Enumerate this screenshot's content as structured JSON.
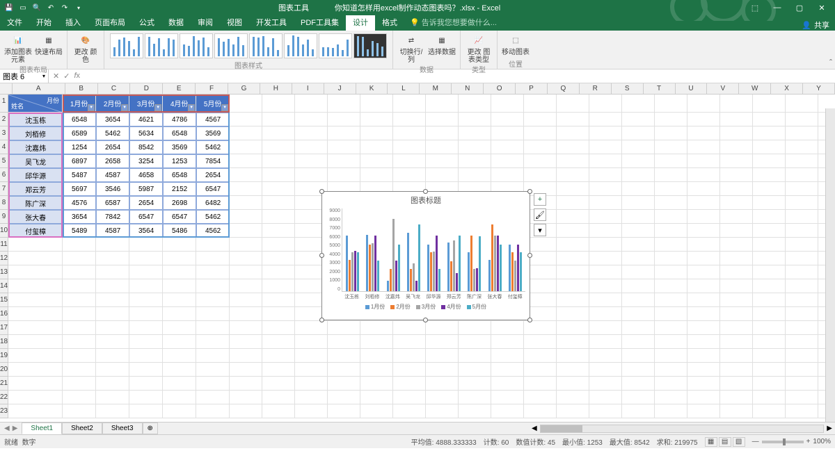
{
  "title_context": "图表工具",
  "title_file": "你知道怎样用excel制作动态图表吗？.xlsx - Excel",
  "menutabs": [
    "文件",
    "开始",
    "插入",
    "页面布局",
    "公式",
    "数据",
    "审阅",
    "视图",
    "开发工具",
    "PDF工具集",
    "设计",
    "格式"
  ],
  "menutab_active_index": 10,
  "tellme": "告诉我您想要做什么...",
  "share": "共享",
  "ribbon": {
    "layout_group": {
      "add_elem": "添加图表\n元素",
      "quick": "快速布局",
      "name": "图表布局"
    },
    "color": "更改\n颜色",
    "styles_group_name": "图表样式",
    "data_group": {
      "switch": "切换行/列",
      "select": "选择数据",
      "name": "数据"
    },
    "type_group": {
      "change": "更改\n图表类型",
      "name": "类型"
    },
    "loc_group": {
      "move": "移动图表",
      "name": "位置"
    }
  },
  "namebox": "图表 6",
  "columns": [
    "A",
    "B",
    "C",
    "D",
    "E",
    "F",
    "G",
    "H",
    "I",
    "J",
    "K",
    "L",
    "M",
    "N",
    "O",
    "P",
    "Q",
    "R",
    "S",
    "T",
    "U",
    "V",
    "W",
    "X",
    "Y"
  ],
  "row_count": 23,
  "table": {
    "corner_top": "月份",
    "corner_bottom": "姓名",
    "headers": [
      "1月份",
      "2月份",
      "3月份",
      "4月份",
      "5月份"
    ],
    "rows": [
      {
        "name": "沈玉栋",
        "v": [
          6548,
          3654,
          4621,
          4786,
          4567
        ]
      },
      {
        "name": "刘栢修",
        "v": [
          6589,
          5462,
          5634,
          6548,
          3569
        ]
      },
      {
        "name": "沈嘉炜",
        "v": [
          1254,
          2654,
          8542,
          3569,
          5462
        ]
      },
      {
        "name": "吴飞龙",
        "v": [
          6897,
          2658,
          3254,
          1253,
          7854
        ]
      },
      {
        "name": "邱华源",
        "v": [
          5487,
          4587,
          4658,
          6548,
          2654
        ]
      },
      {
        "name": "郑云芳",
        "v": [
          5697,
          3546,
          5987,
          2152,
          6547
        ]
      },
      {
        "name": "陈广深",
        "v": [
          4576,
          6587,
          2654,
          2698,
          6482
        ]
      },
      {
        "name": "张大春",
        "v": [
          3654,
          7842,
          6547,
          6547,
          5462
        ]
      },
      {
        "name": "付玺樟",
        "v": [
          5489,
          4587,
          3564,
          5486,
          4562
        ]
      }
    ]
  },
  "chart_data": {
    "type": "bar",
    "title": "图表标题",
    "categories": [
      "沈玉栋",
      "刘栢修",
      "沈嘉炜",
      "吴飞龙",
      "邱华源",
      "郑云芳",
      "陈广深",
      "张大春",
      "付玺樟"
    ],
    "series": [
      {
        "name": "1月份",
        "color": "#5b9bd5",
        "values": [
          6548,
          6589,
          1254,
          6897,
          5487,
          5697,
          4576,
          3654,
          5489
        ]
      },
      {
        "name": "2月份",
        "color": "#ed7d31",
        "values": [
          3654,
          5462,
          2654,
          2658,
          4587,
          3546,
          6587,
          7842,
          4587
        ]
      },
      {
        "name": "3月份",
        "color": "#a5a5a5",
        "values": [
          4621,
          5634,
          8542,
          3254,
          4658,
          5987,
          2654,
          6547,
          3564
        ]
      },
      {
        "name": "4月份",
        "color": "#7030a0",
        "values": [
          4786,
          6548,
          3569,
          1253,
          6548,
          2152,
          2698,
          6547,
          5486
        ]
      },
      {
        "name": "5月份",
        "color": "#4bacc6",
        "values": [
          4567,
          3569,
          5462,
          7854,
          2654,
          6547,
          6482,
          5462,
          4562
        ]
      }
    ],
    "yticks": [
      0,
      1000,
      2000,
      3000,
      4000,
      5000,
      6000,
      7000,
      8000,
      9000
    ],
    "ylim": [
      0,
      9000
    ]
  },
  "sheets": [
    "Sheet1",
    "Sheet2",
    "Sheet3"
  ],
  "sheet_active": 0,
  "status": {
    "ready": "就绪",
    "mode": "数字",
    "avg_label": "平均值:",
    "avg": "4888.333333",
    "count_label": "计数:",
    "count": "60",
    "numcount_label": "数值计数:",
    "numcount": "45",
    "min_label": "最小值:",
    "min": "1253",
    "max_label": "最大值:",
    "max": "8542",
    "sum_label": "求和:",
    "sum": "219975",
    "zoom": "100%"
  }
}
